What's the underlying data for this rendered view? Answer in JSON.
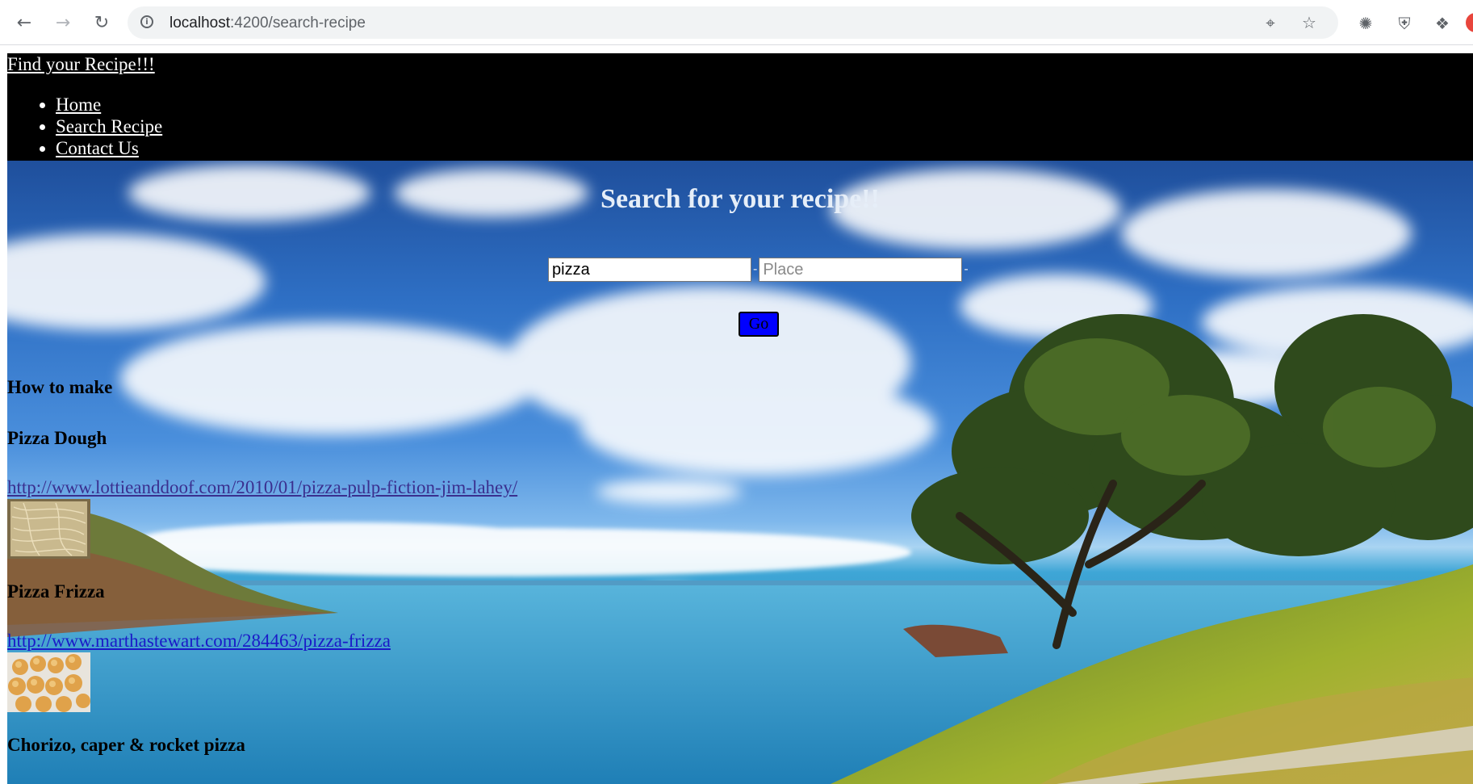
{
  "browser": {
    "url_host": "localhost",
    "url_path": ":4200/search-recipe"
  },
  "page": {
    "brand": "Find your Recipe!!!",
    "nav": [
      "Home",
      "Search Recipe",
      "Contact Us"
    ],
    "heading": "Search for your recipe!!",
    "search": {
      "query_value": "pizza",
      "place_placeholder": "Place",
      "separator": "-",
      "go_label": "Go"
    },
    "results_intro": "How to make",
    "results": [
      {
        "title": "Pizza Dough",
        "link": "http://www.lottieanddoof.com/2010/01/pizza-pulp-fiction-jim-lahey/"
      },
      {
        "title": "Pizza Frizza",
        "link": "http://www.marthastewart.com/284463/pizza-frizza"
      },
      {
        "title": "Chorizo, caper & rocket pizza"
      }
    ]
  },
  "colors": {
    "topbar": "#000000",
    "go_button": "#0000ff"
  }
}
